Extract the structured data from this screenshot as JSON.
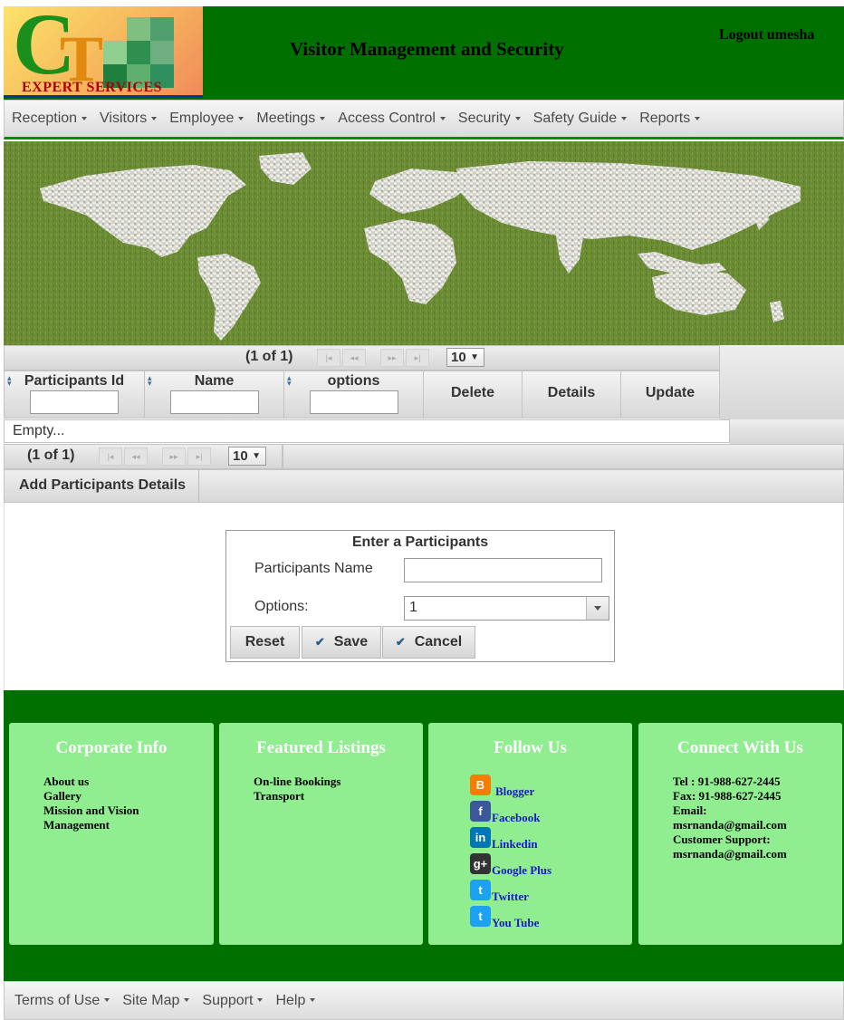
{
  "header": {
    "logo_text": "EXPERT SERVICES",
    "logo_letters": "CT",
    "title": "Visitor Management and Security",
    "logout": "Logout umesha"
  },
  "menu": [
    {
      "label": "Reception"
    },
    {
      "label": "Visitors"
    },
    {
      "label": "Employee"
    },
    {
      "label": "Meetings"
    },
    {
      "label": "Access Control"
    },
    {
      "label": "Security"
    },
    {
      "label": "Safety Guide"
    },
    {
      "label": "Reports"
    }
  ],
  "table": {
    "top_pager_text": "(1 of 1)",
    "bottom_pager_text": "(1 of 1)",
    "rows_per_page": "10",
    "columns": [
      {
        "label": "Participants Id",
        "filter": ""
      },
      {
        "label": "Name",
        "filter": ""
      },
      {
        "label": "options",
        "filter": ""
      }
    ],
    "actions": [
      "Delete",
      "Details",
      "Update"
    ],
    "empty_message": "Empty..."
  },
  "add_button": "Add Participants Details",
  "form": {
    "title": "Enter a Participants",
    "name_label": "Participants Name",
    "name_value": "",
    "options_label": "Options:",
    "options_value": "1",
    "reset": "Reset",
    "save": "Save",
    "cancel": "Cancel"
  },
  "footer": {
    "corporate": {
      "title": "Corporate Info",
      "links": [
        "About us",
        "Gallery",
        "Mission and Vision",
        "Management"
      ]
    },
    "featured": {
      "title": "Featured Listings",
      "links": [
        "On-line Bookings",
        "Transport"
      ]
    },
    "follow": {
      "title": "Follow Us",
      "links": [
        {
          "label": "Blogger",
          "icon": "blogger-icon",
          "color": "#f57d00",
          "glyph": "B"
        },
        {
          "label": "Facebook",
          "icon": "facebook-icon",
          "color": "#3b5998",
          "glyph": "f"
        },
        {
          "label": "Linkedin",
          "icon": "linkedin-icon",
          "color": "#0077b5",
          "glyph": "in"
        },
        {
          "label": "Google Plus",
          "icon": "google-plus-icon",
          "color": "#333333",
          "glyph": "g+"
        },
        {
          "label": "Twitter",
          "icon": "twitter-icon",
          "color": "#1da1f2",
          "glyph": "t"
        },
        {
          "label": "You Tube",
          "icon": "youtube-icon",
          "color": "#1da1f2",
          "glyph": "t"
        }
      ]
    },
    "connect": {
      "title": "Connect With Us",
      "lines": [
        "Tel : 91-988-627-2445",
        "Fax: 91-988-627-2445",
        "Email:",
        "msrnanda@gmail.com",
        "Customer Support:",
        "msrnanda@gmail.com"
      ]
    }
  },
  "bottom_menu": [
    {
      "label": "Terms of Use"
    },
    {
      "label": "Site Map"
    },
    {
      "label": "Support"
    },
    {
      "label": "Help"
    }
  ],
  "colors": {
    "header_green": "#007000",
    "footer_card": "#90ee90",
    "link_blue": "#1919c8"
  }
}
